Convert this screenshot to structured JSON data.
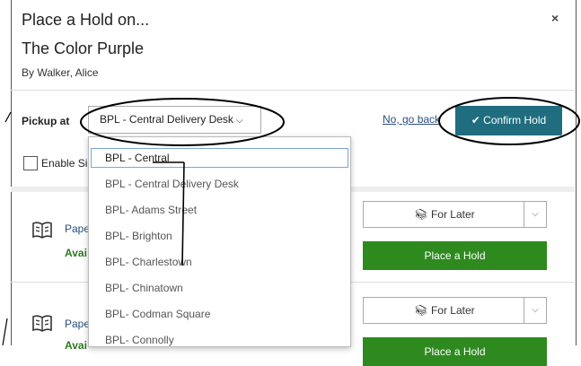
{
  "dialog": {
    "heading": "Place a Hold on...",
    "book_title": "The Color Purple",
    "author": "By Walker, Alice",
    "close_label": "×"
  },
  "pickup": {
    "label": "Pickup at",
    "selected": "BPL - Central Delivery Desk",
    "no_go_back": "No, go back",
    "confirm_label": "✔ Confirm Hold",
    "enable_label": "Enable Si"
  },
  "dropdown": {
    "options": [
      "BPL - Central",
      "BPL - Central Delivery Desk",
      "BPL- Adams Street",
      "BPL- Brighton",
      "BPL- Charlestown",
      "BPL- Chinatown",
      "BPL- Codman Square",
      "BPL- Connolly"
    ],
    "highlighted_index": 0
  },
  "results": [
    {
      "format": "Pape",
      "status": "Avai",
      "for_later": "For Later",
      "place_hold": "Place a Hold"
    },
    {
      "format": "Pape",
      "status": "Avai",
      "for_later": "For Later",
      "place_hold": "Place a Hold"
    }
  ],
  "colors": {
    "confirm_bg": "#1f6d7e",
    "place_hold_bg": "#2e8a1e",
    "link": "#2a4f7a"
  }
}
